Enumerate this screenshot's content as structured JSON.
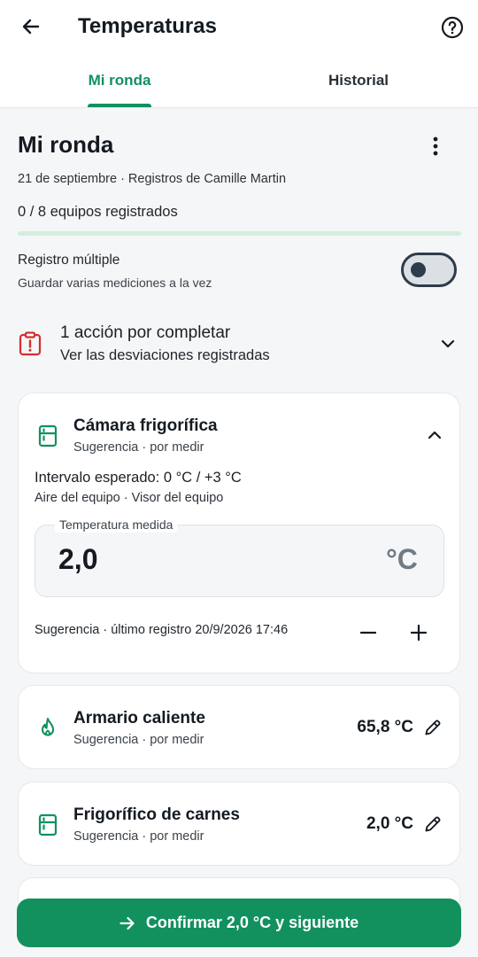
{
  "header": {
    "title": "Temperaturas",
    "tabs": [
      {
        "label": "Mi ronda",
        "active": true
      },
      {
        "label": "Historial",
        "active": false
      }
    ]
  },
  "round": {
    "title": "Mi ronda",
    "subtitle": "21 de septiembre · Registros de Camille Martin",
    "count_text": "0 / 8 equipos registrados",
    "progress_fraction": 0
  },
  "multi": {
    "label": "Registro múltiple",
    "description": "Guardar varias mediciones a la vez",
    "enabled": false
  },
  "alert": {
    "title": "1 acción por completar",
    "subtitle": "Ver las desviaciones registradas"
  },
  "equipment": [
    {
      "name": "Cámara frigorífica",
      "status": "Sugerencia · por medir",
      "icon": "fridge-icon",
      "expanded": true,
      "range": "Intervalo esperado: 0 °C / +3 °C",
      "range_detail": "Aire del equipo · Visor del equipo",
      "field_label": "Temperatura medida",
      "value": "2,0",
      "unit": "°C",
      "last_record": "Sugerencia · último registro 20/9/2026 17:46"
    },
    {
      "name": "Armario caliente",
      "status": "Sugerencia · por medir",
      "icon": "flame-icon",
      "value": "65,8 °C"
    },
    {
      "name": "Frigorífico de carnes",
      "status": "Sugerencia · por medir",
      "icon": "fridge-icon",
      "value": "2,0 °C"
    }
  ],
  "confirm_label": "Confirmar 2,0 °C y siguiente",
  "colors": {
    "accent": "#12915f",
    "alert": "#d32f2f",
    "toggle": "#2e3b4a"
  }
}
